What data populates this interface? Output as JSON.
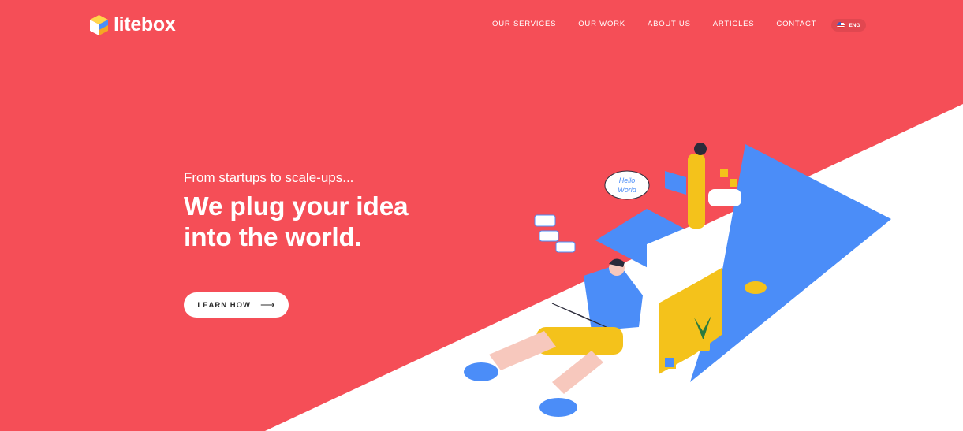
{
  "brand": {
    "name": "litebox"
  },
  "nav": {
    "items": [
      "OUR SERVICES",
      "OUR WORK",
      "ABOUT US",
      "ARTICLES",
      "CONTACT"
    ]
  },
  "language": {
    "label": "ENG"
  },
  "hero": {
    "eyebrow": "From startups to scale-ups...",
    "headline_line1": "We plug your idea",
    "headline_line2": "into the world.",
    "cta_label": "LEARN HOW",
    "cta_arrow": "⟶"
  },
  "illustration": {
    "speech_bubble_line1": "Hello",
    "speech_bubble_line2": "World"
  },
  "colors": {
    "brand_red": "#f54e57",
    "accent_blue": "#4b8df8",
    "accent_yellow": "#f4c21b",
    "white": "#ffffff"
  }
}
